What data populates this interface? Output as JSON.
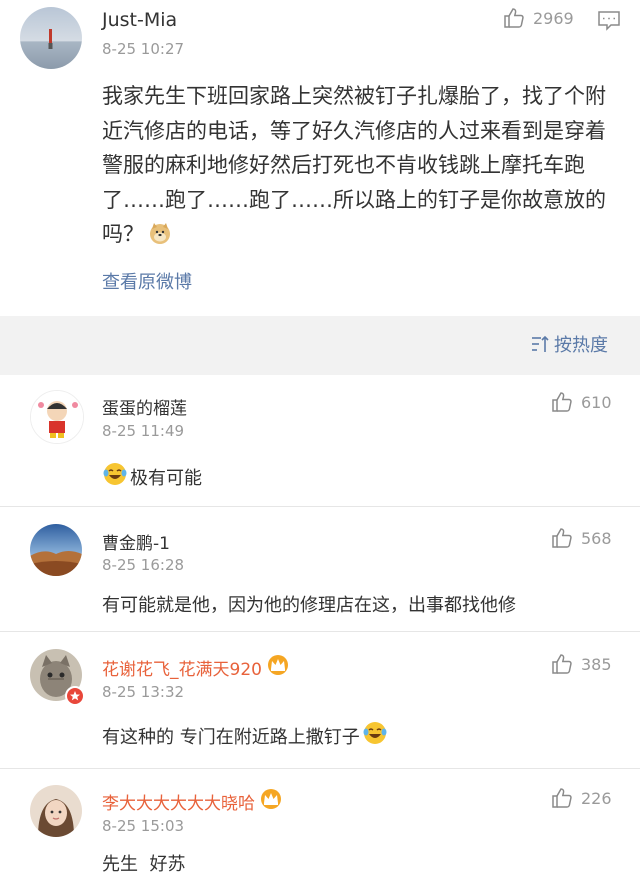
{
  "post": {
    "author": "Just-Mia",
    "time": "8-25 10:27",
    "likes": "2969",
    "text": "我家先生下班回家路上突然被钉子扎爆胎了，找了个附近汽修店的电话，等了好久汽修店的人过来看到是穿着警服的麻利地修好然后打死也不肯收钱跳上摩托车跑了……跑了……跑了……所以路上的钉子是你故意放的吗？",
    "view_original": "查看原微博"
  },
  "sort": {
    "label": "按热度"
  },
  "comments": [
    {
      "name": "蛋蛋的榴莲",
      "time": "8-25 11:49",
      "likes": "610",
      "text": "极有可能",
      "emoji_before": "laugh-cry-emoji",
      "vip": false
    },
    {
      "name": "曹金鹏-1",
      "time": "8-25 16:28",
      "likes": "568",
      "text": "有可能就是他，因为他的修理店在这，出事都找他修",
      "vip": false
    },
    {
      "name": "花谢花飞_花满天920",
      "time": "8-25 13:32",
      "likes": "385",
      "text": "有这种的 专门在附近路上撒钉子",
      "emoji_after": "laugh-cry-emoji",
      "vip": true
    },
    {
      "name": "李大大大大大大晓哈",
      "time": "8-25 15:03",
      "likes": "226",
      "text": "先生  好苏",
      "vip": true
    }
  ],
  "colors": {
    "link": "#5b7aa8",
    "vip_name": "#e8623b",
    "gap": "#f2f2f2",
    "meta": "#9a9a9a"
  }
}
